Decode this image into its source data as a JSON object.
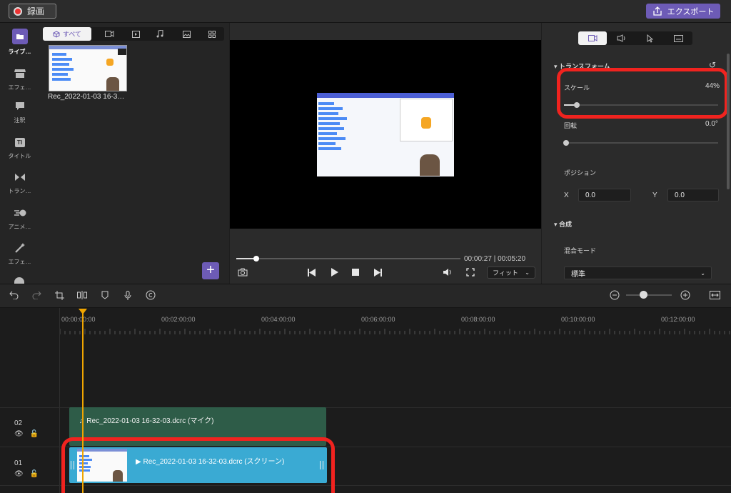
{
  "topbar": {
    "record_label": "録画",
    "export_label": "エクスポート"
  },
  "sidebar": {
    "items": [
      {
        "label": "ライブ…",
        "icon": "folder-icon",
        "active": true
      },
      {
        "label": "エフェ…",
        "icon": "store-icon"
      },
      {
        "label": "注釈",
        "icon": "speech-bubble-icon"
      },
      {
        "label": "タイトル",
        "icon": "title-icon"
      },
      {
        "label": "トラン…",
        "icon": "transition-icon"
      },
      {
        "label": "アニメ…",
        "icon": "animation-icon"
      },
      {
        "label": "エフェ…",
        "icon": "magic-wand-icon"
      }
    ]
  },
  "media": {
    "tab_all": "すべて",
    "clip_name": "Rec_2022-01-03 16-3…"
  },
  "player": {
    "time_display": "00:00:27 | 00:05:20",
    "progress": 0.084,
    "fit_label": "フィット"
  },
  "properties": {
    "section_transform": "トランスフォーム",
    "scale_label": "スケール",
    "scale_value": "44%",
    "scale_fraction": 0.44,
    "rotate_label": "回転",
    "rotate_value": "0.0°",
    "position_label": "ポジション",
    "x_label": "X",
    "x_value": "0.0",
    "y_label": "Y",
    "y_value": "0.0",
    "section_composite": "合成",
    "blend_label": "混合モード",
    "blend_value": "標準"
  },
  "timeline": {
    "ticks": [
      "00:00:00:00",
      "00:02:00:00",
      "00:04:00:00",
      "00:06:00:00",
      "00:08:00:00",
      "00:10:00:00",
      "00:12:00:00"
    ],
    "tracks": [
      {
        "number": "02",
        "clip": "Rec_2022-01-03 16-32-03.dcrc (マイク)"
      },
      {
        "number": "01",
        "clip": "Rec_2022-01-03 16-32-03.dcrc (スクリーン)"
      }
    ]
  },
  "colors": {
    "accent": "#6d5bb6",
    "highlight": "#f0231f",
    "playhead": "#f0a500",
    "video_clip": "#3aaad3",
    "audio_clip": "#2e5c48"
  }
}
